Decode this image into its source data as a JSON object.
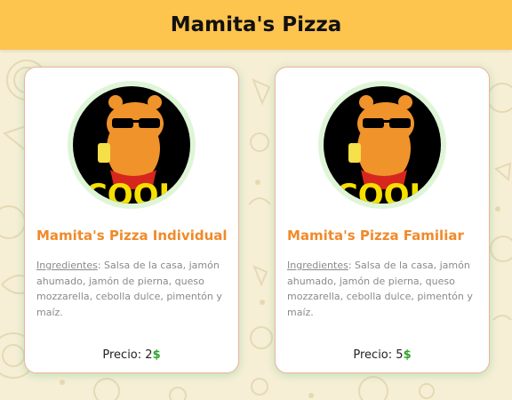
{
  "app": {
    "title": "Mamita's Pizza"
  },
  "products": [
    {
      "name": "Mamita's Pizza Individual",
      "ingredients_label": "Ingredientes",
      "ingredients_text": ": Salsa de la casa, jamón ahumado, jamón de pierna, queso mozzarella, cebolla dulce, pimentón y maíz.",
      "price_label": "Precio: ",
      "price_value": "2",
      "currency": "$",
      "image_text": "COOL"
    },
    {
      "name": "Mamita's Pizza Familiar",
      "ingredients_label": "Ingredientes",
      "ingredients_text": ": Salsa de la casa, jamón ahumado, jamón de pierna, queso mozzarella, cebolla dulce, pimentón y maíz.",
      "price_label": "Precio: ",
      "price_value": "5",
      "currency": "$",
      "image_text": "COOL"
    }
  ],
  "colors": {
    "header": "#fdc44e",
    "accent": "#f08a2a",
    "currency": "#2aa52a",
    "background": "#f6efd6"
  }
}
